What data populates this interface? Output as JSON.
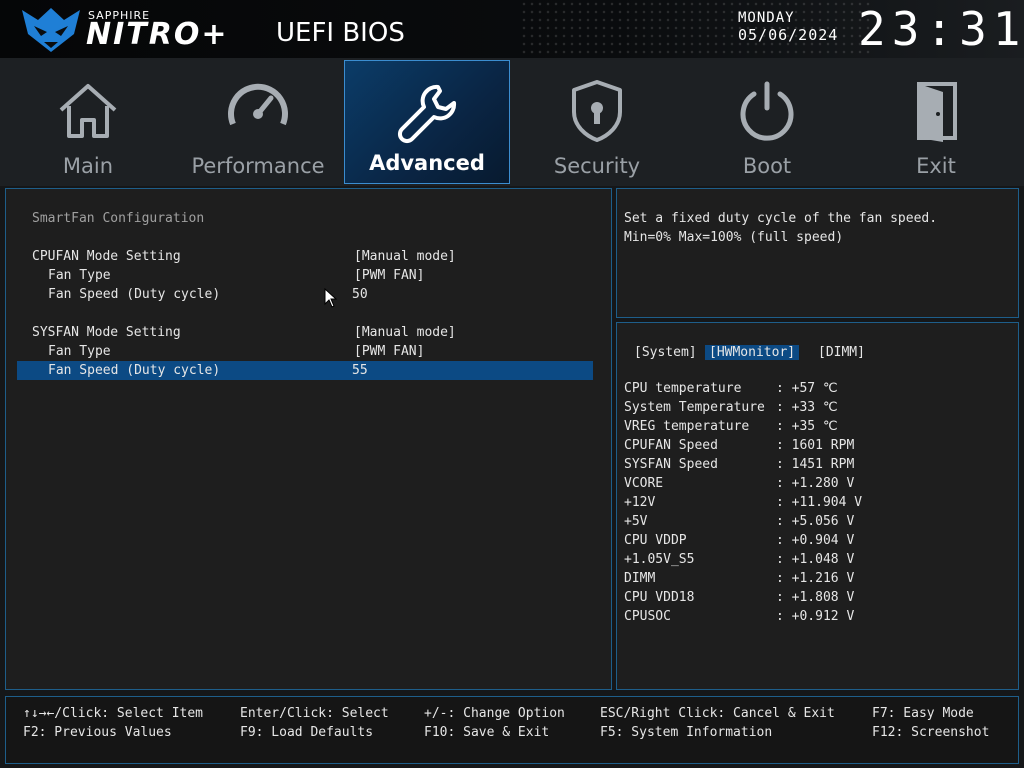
{
  "header": {
    "brand_sub": "SAPPHIRE",
    "brand_name": "NITRO+",
    "title": "UEFI BIOS",
    "day": "MONDAY",
    "date": "05/06/2024",
    "time": "23:31"
  },
  "tabs": [
    {
      "label": "Main",
      "icon": "home-icon"
    },
    {
      "label": "Performance",
      "icon": "speedometer-icon"
    },
    {
      "label": "Advanced",
      "icon": "wrench-icon",
      "active": true
    },
    {
      "label": "Security",
      "icon": "shield-lock-icon"
    },
    {
      "label": "Boot",
      "icon": "power-icon"
    },
    {
      "label": "Exit",
      "icon": "door-exit-icon"
    }
  ],
  "main": {
    "section_title": "SmartFan Configuration",
    "cpufan": {
      "mode_label": "CPUFAN Mode Setting",
      "mode_value": "[Manual mode]",
      "type_label": "Fan Type",
      "type_value": "[PWM FAN]",
      "speed_label": "Fan Speed (Duty cycle)",
      "speed_value": "50"
    },
    "sysfan": {
      "mode_label": "SYSFAN Mode Setting",
      "mode_value": "[Manual mode]",
      "type_label": "Fan Type",
      "type_value": "[PWM FAN]",
      "speed_label": "Fan Speed (Duty cycle)",
      "speed_value": "55"
    }
  },
  "help": {
    "line1": "Set a fixed duty cycle of the fan speed.",
    "line2": "Min=0% Max=100% (full speed)"
  },
  "hwmonitor": {
    "tabs": [
      "[System]",
      "[HWMonitor]",
      "[DIMM]"
    ],
    "rows": [
      {
        "label": "CPU temperature",
        "value": ": +57 ℃"
      },
      {
        "label": "System Temperature",
        "value": ": +33 ℃"
      },
      {
        "label": "VREG temperature",
        "value": ": +35 ℃"
      },
      {
        "label": "CPUFAN Speed",
        "value": ": 1601 RPM"
      },
      {
        "label": "SYSFAN Speed",
        "value": ": 1451 RPM"
      },
      {
        "label": "VCORE",
        "value": ": +1.280 V"
      },
      {
        "label": "+12V",
        "value": ": +11.904 V"
      },
      {
        "label": "+5V",
        "value": ": +5.056 V"
      },
      {
        "label": "CPU VDDP",
        "value": ": +0.904 V"
      },
      {
        "label": "+1.05V_S5",
        "value": ": +1.048 V"
      },
      {
        "label": "DIMM",
        "value": ": +1.216 V"
      },
      {
        "label": "CPU VDD18",
        "value": ": +1.808 V"
      },
      {
        "label": "CPUSOC",
        "value": ": +0.912 V"
      }
    ]
  },
  "footer": {
    "select_item": "↑↓→←/Click: Select Item",
    "previous_values": "F2: Previous Values",
    "enter_select": "Enter/Click: Select",
    "load_defaults": "F9: Load Defaults",
    "change_option": "+/-: Change Option",
    "save_exit": "F10: Save & Exit",
    "cancel_exit": "ESC/Right Click: Cancel & Exit",
    "system_info": "F5: System Information",
    "easy_mode": "F7: Easy Mode",
    "screenshot": "F12: Screenshot"
  },
  "colors": {
    "accent": "#0c4a84",
    "panel_border": "#1e5e8a",
    "active_tab": "#0b3c68"
  }
}
